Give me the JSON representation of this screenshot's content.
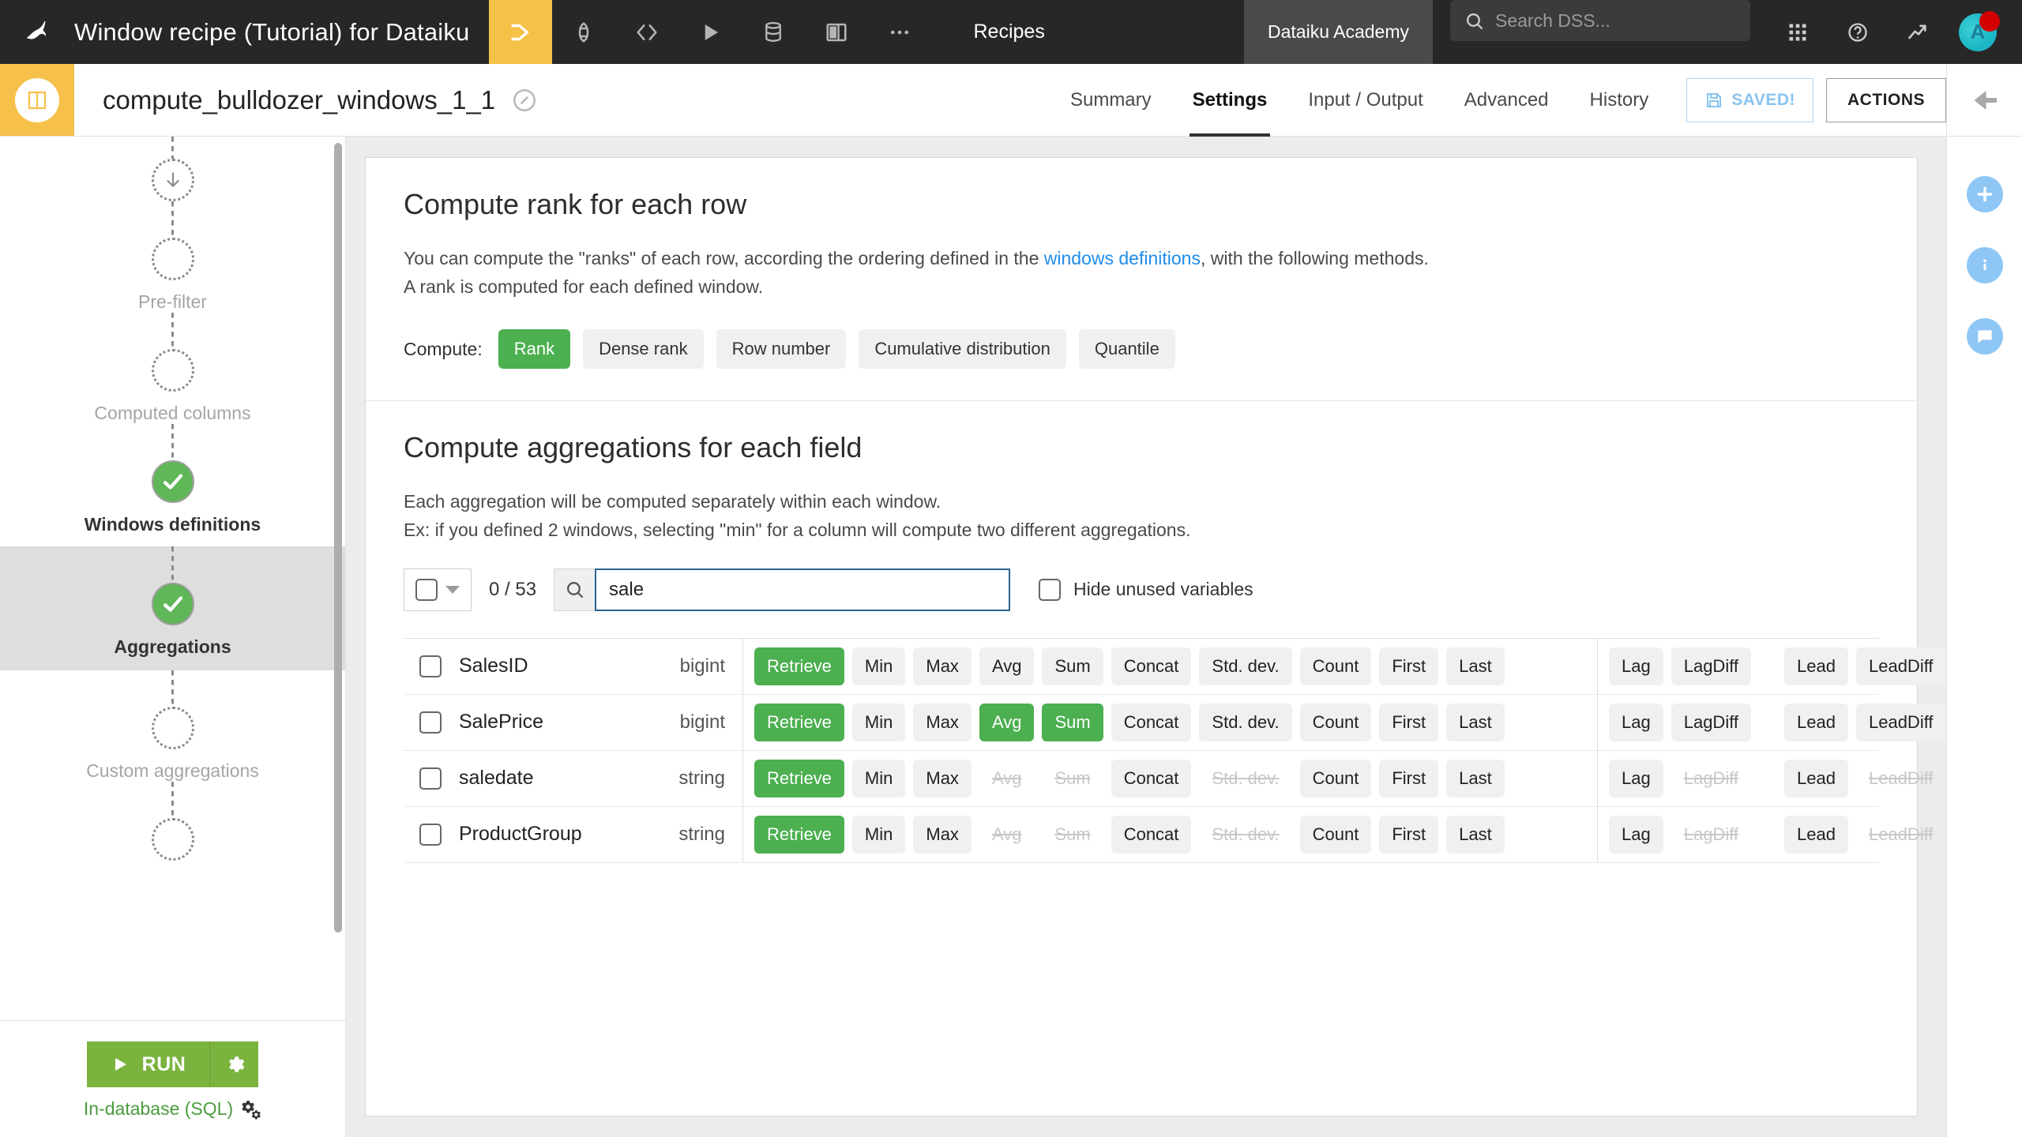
{
  "topbar": {
    "logo_icon": "dataiku-bird-icon",
    "project_title": "Window recipe (Tutorial) for Dataiku",
    "recipe_chip_icon": "window-recipe-icon",
    "icons": [
      {
        "name": "flow-icon",
        "label": "Flow"
      },
      {
        "name": "code-icon",
        "label": "Code"
      },
      {
        "name": "play-icon",
        "label": "Jobs"
      },
      {
        "name": "database-icon",
        "label": "Datasets"
      },
      {
        "name": "dashboard-icon",
        "label": "Dashboards"
      },
      {
        "name": "more-icon",
        "label": "More"
      }
    ],
    "recipes_label": "Recipes",
    "academy_label": "Dataiku Academy",
    "search": {
      "placeholder": "Search DSS...",
      "value": "",
      "icon": "search-icon"
    },
    "right_icons": [
      {
        "name": "apps-grid-icon"
      },
      {
        "name": "help-icon"
      },
      {
        "name": "trend-icon"
      }
    ],
    "avatar": {
      "initial": "A",
      "badge": true,
      "badge_color": "#d40000"
    }
  },
  "subheader": {
    "recipe_icon": "window-recipe-icon",
    "recipe_name": "compute_bulldozer_windows_1_1",
    "nav_icon": "navigate-icon",
    "tabs": [
      {
        "label": "Summary",
        "active": false
      },
      {
        "label": "Settings",
        "active": true
      },
      {
        "label": "Input / Output",
        "active": false
      },
      {
        "label": "Advanced",
        "active": false
      },
      {
        "label": "History",
        "active": false
      }
    ],
    "saved_label": "SAVED!",
    "saved_icon": "floppy-disk-icon",
    "actions_label": "ACTIONS",
    "collapse_icon": "arrow-left-icon"
  },
  "steps": {
    "items": [
      {
        "label": "",
        "state": "input",
        "icon": "arrow-down-icon"
      },
      {
        "label": "Pre-filter",
        "state": "empty"
      },
      {
        "label": "Computed columns",
        "state": "empty"
      },
      {
        "label": "Windows definitions",
        "state": "done"
      },
      {
        "label": "Aggregations",
        "state": "done",
        "selected": true
      },
      {
        "label": "Custom aggregations",
        "state": "empty"
      },
      {
        "label": "",
        "state": "output"
      }
    ],
    "run_label": "RUN",
    "run_icon": "play-icon",
    "run_gear_icon": "gear-icon",
    "engine_label": "In-database (SQL)",
    "engine_icon": "gears-icon"
  },
  "rank_section": {
    "title": "Compute rank for each row",
    "description_1_pre": "You can compute the \"ranks\" of each row, according the ordering defined in the ",
    "description_1_link": "windows definitions",
    "description_1_post": ", with the following methods.",
    "description_2": "A rank is computed for each defined window.",
    "compute_label": "Compute:",
    "options": [
      {
        "label": "Rank",
        "selected": true
      },
      {
        "label": "Dense rank",
        "selected": false
      },
      {
        "label": "Row number",
        "selected": false
      },
      {
        "label": "Cumulative distribution",
        "selected": false
      },
      {
        "label": "Quantile",
        "selected": false
      }
    ]
  },
  "agg_section": {
    "title": "Compute aggregations for each field",
    "description_1": "Each aggregation will be computed separately within each window.",
    "description_2": "Ex: if you defined 2 windows, selecting \"min\" for a column will compute two different aggregations.",
    "select_count": "0 / 53",
    "search": {
      "value": "sale",
      "placeholder": "",
      "icon": "search-icon"
    },
    "hide_unused_label": "Hide unused variables",
    "hide_unused_checked": false,
    "select_all_checked": false,
    "agg_columns": [
      "Retrieve",
      "Min",
      "Max",
      "Avg",
      "Sum",
      "Concat",
      "Std. dev.",
      "Count",
      "First",
      "Last"
    ],
    "lag_columns": [
      "Lag",
      "LagDiff",
      "Lead",
      "LeadDiff"
    ],
    "rows": [
      {
        "name": "SalesID",
        "type": "bigint",
        "checked": false,
        "aggs": [
          "on",
          "idle",
          "idle",
          "idle",
          "idle",
          "idle",
          "idle",
          "idle",
          "idle",
          "idle"
        ],
        "lags": [
          "idle",
          "idle",
          "idle",
          "idle"
        ]
      },
      {
        "name": "SalePrice",
        "type": "bigint",
        "checked": false,
        "aggs": [
          "on",
          "idle",
          "idle",
          "on",
          "on",
          "idle",
          "idle",
          "idle",
          "idle",
          "idle"
        ],
        "lags": [
          "idle",
          "idle",
          "idle",
          "idle"
        ]
      },
      {
        "name": "saledate",
        "type": "string",
        "checked": false,
        "aggs": [
          "on",
          "idle",
          "idle",
          "off",
          "off",
          "idle",
          "off",
          "idle",
          "idle",
          "idle"
        ],
        "lags": [
          "idle",
          "off",
          "idle",
          "off"
        ]
      },
      {
        "name": "ProductGroup",
        "type": "string",
        "checked": false,
        "aggs": [
          "on",
          "idle",
          "idle",
          "off",
          "off",
          "idle",
          "off",
          "idle",
          "idle",
          "idle"
        ],
        "lags": [
          "idle",
          "off",
          "idle",
          "off"
        ]
      }
    ]
  },
  "rail": {
    "buttons": [
      {
        "name": "add-icon"
      },
      {
        "name": "info-icon"
      },
      {
        "name": "comment-icon"
      }
    ]
  },
  "colors": {
    "accent_green": "#4caf50",
    "run_green": "#7bb33f",
    "recipe_yellow": "#f7c04a",
    "link_blue": "#1f8ceb",
    "topbar_dark": "#272727"
  }
}
